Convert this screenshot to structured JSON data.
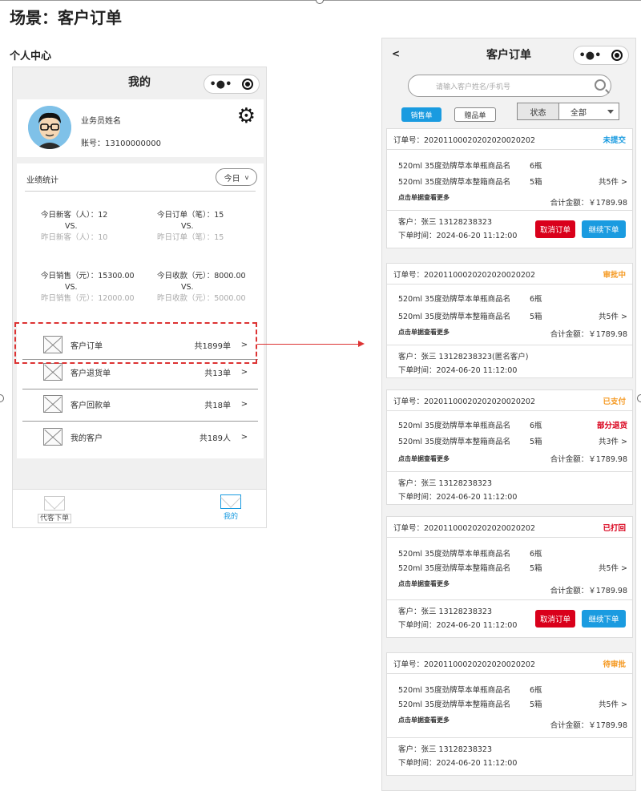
{
  "scene_title": "场景：客户订单",
  "section_label": "个人中心",
  "colors": {
    "accent_blue": "#1a9be0",
    "accent_red": "#d9001b",
    "status_blue": "#1a9be0",
    "status_orange": "#f59a23"
  },
  "left": {
    "nav_title": "我的",
    "user": {
      "name": "业务员姓名",
      "account": "账号：13100000000"
    },
    "stats": {
      "head": "业绩统计",
      "range": "今日",
      "items": [
        {
          "now": "今日新客（人）：12",
          "vs": "VS.",
          "prev": "昨日新客（人）：10"
        },
        {
          "now": "今日订单（笔）：15",
          "vs": "VS.",
          "prev": "昨日订单（笔）：15"
        },
        {
          "now": "今日销售（元）：15300.00",
          "vs": "VS.",
          "prev": "昨日销售（元）：12000.00"
        },
        {
          "now": "今日收款（元）：8000.00",
          "vs": "VS.",
          "prev": "昨日收款（元）：5000.00"
        }
      ]
    },
    "menu": [
      {
        "label": "客户订单",
        "count": "共1899单",
        "arrow": ">"
      },
      {
        "label": "客户退货单",
        "count": "共13单",
        "arrow": ">"
      },
      {
        "label": "客户回款单",
        "count": "共18单",
        "arrow": ">"
      },
      {
        "label": "我的客户",
        "count": "共189人",
        "arrow": ">"
      }
    ],
    "tabs": {
      "order_for": "代客下单",
      "mine": "我的"
    }
  },
  "right": {
    "back": "<",
    "nav_title": "客户订单",
    "search_placeholder": "请输入客户姓名/手机号",
    "seg_sales": "销售单",
    "seg_gift": "赠品单",
    "filter_label": "状态",
    "filter_value": "全部",
    "orders": [
      {
        "no": "订单号：20201100020202020020202",
        "status": "未提交",
        "status_color": "#1a9be0",
        "item1": "520ml 35度劲牌草本单瓶商品名",
        "qty1": "6瓶",
        "item2": "520ml 35度劲牌草本整箱商品名",
        "qty2": "5箱",
        "total_items": "共5件 >",
        "more": "点击单据查看更多",
        "sum": "合计金额：￥1789.98",
        "customer": "客户：张三   13128238323",
        "time": "下单时间：2024-06-20 11:12:00",
        "cancel": "取消订单",
        "cont": "继续下单"
      },
      {
        "no": "订单号：20201100020202020020202",
        "status": "审批中",
        "status_color": "#f59a23",
        "item1": "520ml 35度劲牌草本单瓶商品名",
        "qty1": "6瓶",
        "item2": "520ml 35度劲牌草本整箱商品名",
        "qty2": "5箱",
        "total_items": "共5件 >",
        "more": "点击单据查看更多",
        "sum": "合计金额：￥1789.98",
        "customer": "客户：张三   13128238323(匿名客户)",
        "time": "下单时间：2024-06-20 11:12:00"
      },
      {
        "no": "订单号：20201100020202020020202",
        "status": "已支付",
        "status_color": "#f59a23",
        "sub_status": "部分退货",
        "item1": "520ml 35度劲牌草本单瓶商品名",
        "qty1": "6瓶",
        "item2": "520ml 35度劲牌草本整箱商品名",
        "qty2": "5箱",
        "total_items": "共3件 >",
        "more": "点击单据查看更多",
        "sum": "合计金额：￥1789.98",
        "customer": "客户：张三   13128238323",
        "time": "下单时间：2024-06-20 11:12:00"
      },
      {
        "no": "订单号：20201100020202020020202",
        "status": "已打回",
        "status_color": "#d9001b",
        "item1": "520ml 35度劲牌草本单瓶商品名",
        "qty1": "6瓶",
        "item2": "520ml 35度劲牌草本整箱商品名",
        "qty2": "5箱",
        "total_items": "共5件 >",
        "more": "点击单据查看更多",
        "sum": "合计金额：￥1789.98",
        "customer": "客户：张三   13128238323",
        "time": "下单时间：2024-06-20 11:12:00",
        "cancel": "取消订单",
        "cont": "继续下单"
      },
      {
        "no": "订单号：20201100020202020020202",
        "status": "待审批",
        "status_color": "#f59a23",
        "item1": "520ml 35度劲牌草本单瓶商品名",
        "qty1": "6瓶",
        "item2": "520ml 35度劲牌草本整箱商品名",
        "qty2": "5箱",
        "total_items": "共5件 >",
        "more": "点击单据查看更多",
        "sum": "合计金额：￥1789.98",
        "customer": "客户：张三   13128238323",
        "time": "下单时间：2024-06-20 11:12:00"
      }
    ]
  }
}
